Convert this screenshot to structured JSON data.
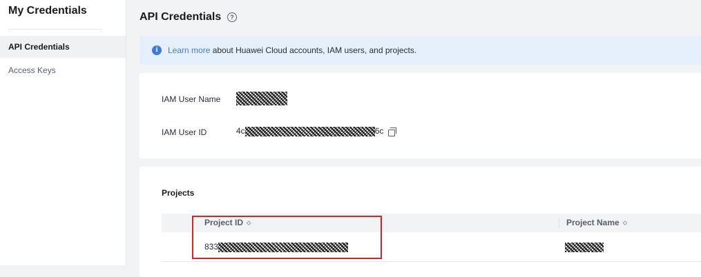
{
  "sidebar": {
    "title": "My Credentials",
    "items": [
      {
        "label": "API Credentials",
        "active": true
      },
      {
        "label": "Access Keys",
        "active": false
      }
    ]
  },
  "header": {
    "title": "API Credentials",
    "help_icon": "question-circle-icon",
    "help_glyph": "?"
  },
  "info": {
    "icon": "info-icon",
    "icon_glyph": "i",
    "link_text": "Learn more",
    "text": " about Huawei Cloud accounts, IAM users, and projects."
  },
  "user": {
    "name_label": "IAM User Name",
    "id_label": "IAM User ID",
    "id_prefix": "4c",
    "id_suffix": "6c",
    "copy_icon": "copy-icon"
  },
  "projects": {
    "title": "Projects",
    "columns": [
      "Project ID",
      "Project Name"
    ],
    "sort_icon": "sort-icon",
    "rows": [
      {
        "id_prefix": "833"
      }
    ]
  },
  "colors": {
    "accent": "#3f7ae0",
    "info_bg": "#e6f0fd",
    "highlight": "#d0232a"
  }
}
